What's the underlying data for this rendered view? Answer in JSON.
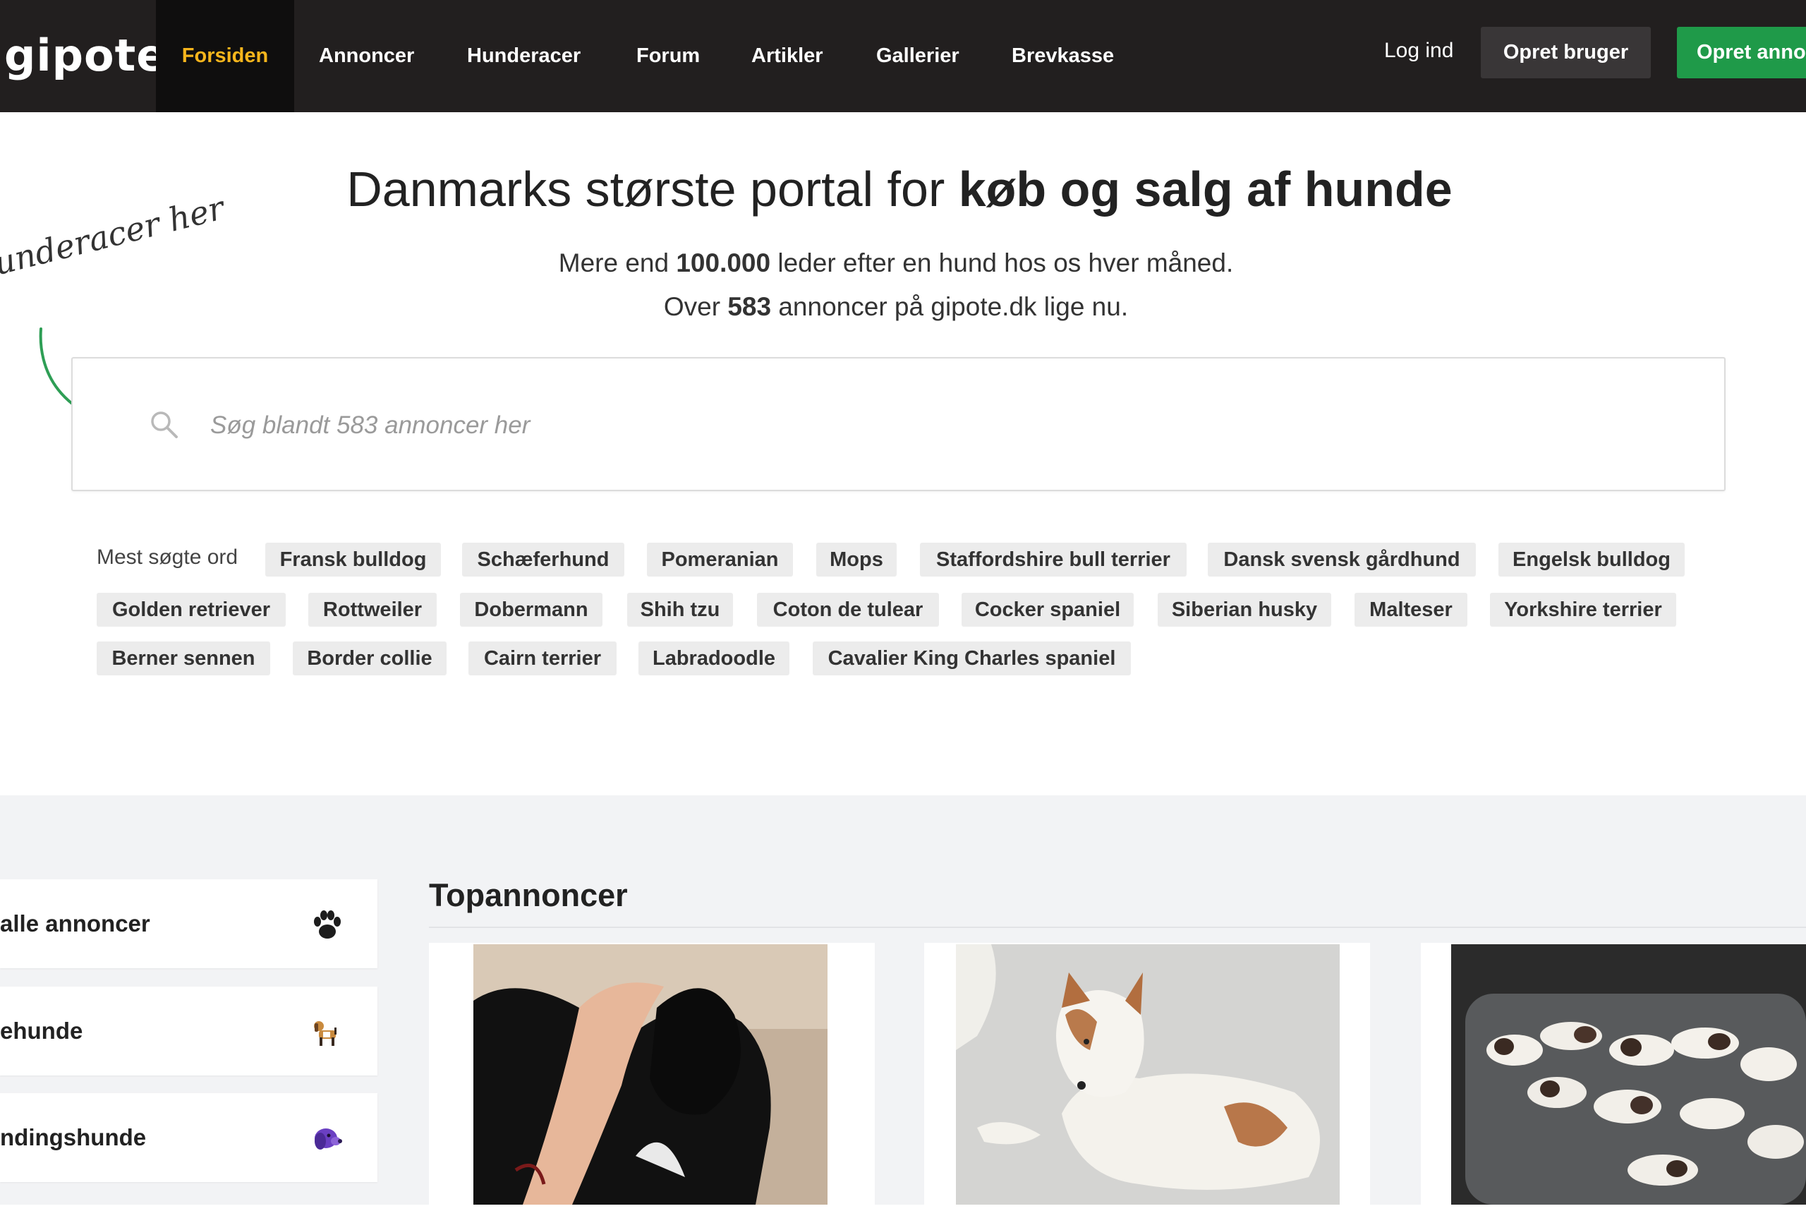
{
  "header": {
    "logo_text": "gipote",
    "nav": [
      {
        "label": "Forsiden",
        "active": true
      },
      {
        "label": "Annoncer"
      },
      {
        "label": "Hunderacer"
      },
      {
        "label": "Forum"
      },
      {
        "label": "Artikler"
      },
      {
        "label": "Gallerier"
      },
      {
        "label": "Brevkasse"
      }
    ],
    "login_label": "Log ind",
    "register_label": "Opret bruger",
    "create_ad_label": "Opret annonce",
    "colors": {
      "bar": "#221f1f",
      "active_text": "#f6b51c",
      "create_button": "#1f9a49"
    }
  },
  "hero": {
    "title_regular": "Danmarks største portal for ",
    "title_bold": "køb og salg af hunde",
    "sub1": {
      "before": "Mere end ",
      "bold": "100.000",
      "after": " leder efter en hund hos os hver måned."
    },
    "sub2": {
      "before": "Over ",
      "bold": "583",
      "after": " annoncer på gipote.dk lige nu."
    },
    "handwritten_hint": "underacer her",
    "search_placeholder": "Søg blandt 583 annoncer her"
  },
  "popular": {
    "label": "Mest søgte ord",
    "tags": [
      "Fransk bulldog",
      "Schæferhund",
      "Pomeranian",
      "Mops",
      "Staffordshire bull terrier",
      "Dansk svensk gårdhund",
      "Engelsk bulldog",
      "Golden retriever",
      "Rottweiler",
      "Dobermann",
      "Shih tzu",
      "Coton de tulear",
      "Cocker spaniel",
      "Siberian husky",
      "Malteser",
      "Yorkshire terrier",
      "Berner sennen",
      "Border collie",
      "Cairn terrier",
      "Labradoodle",
      "Cavalier King Charles spaniel"
    ]
  },
  "categories": [
    {
      "label": "alle annoncer",
      "icon": "paw-icon"
    },
    {
      "label": "ehunde",
      "icon": "beagle-icon"
    },
    {
      "label": "ndingshunde",
      "icon": "dog-head-icon"
    }
  ],
  "top_ads": {
    "title": "Topannoncer",
    "items": [
      {
        "photo": "black-puppy-photo"
      },
      {
        "photo": "white-brown-puppy-photo"
      },
      {
        "photo": "puppy-litter-photo"
      }
    ]
  }
}
